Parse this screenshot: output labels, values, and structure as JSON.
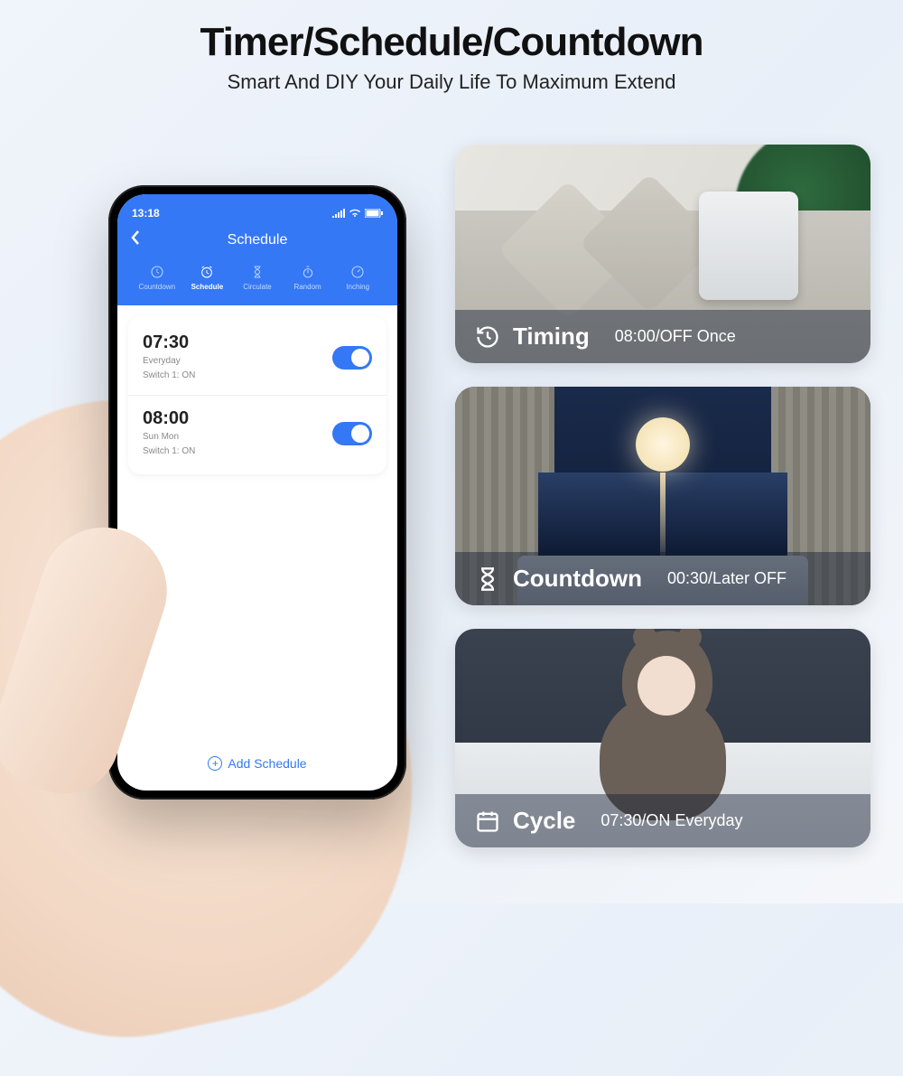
{
  "hero": {
    "title": "Timer/Schedule/Countdown",
    "subtitle": "Smart And DIY Your Daily Life To Maximum Extend"
  },
  "status": {
    "time": "13:18"
  },
  "header": {
    "title": "Schedule"
  },
  "tabs": [
    {
      "label": "Countdown"
    },
    {
      "label": "Schedule"
    },
    {
      "label": "Circulate"
    },
    {
      "label": "Random"
    },
    {
      "label": "Inching"
    }
  ],
  "schedules": [
    {
      "time": "07:30",
      "repeat": "Everyday",
      "switch": "Switch 1: ON",
      "on": true
    },
    {
      "time": "08:00",
      "repeat": "Sun Mon",
      "switch": "Switch 1: ON",
      "on": true
    }
  ],
  "add_label": "Add Schedule",
  "scenes": [
    {
      "label": "Timing",
      "value": "08:00/OFF Once"
    },
    {
      "label": "Countdown",
      "value": "00:30/Later OFF"
    },
    {
      "label": "Cycle",
      "value": "07:30/ON Everyday"
    }
  ]
}
